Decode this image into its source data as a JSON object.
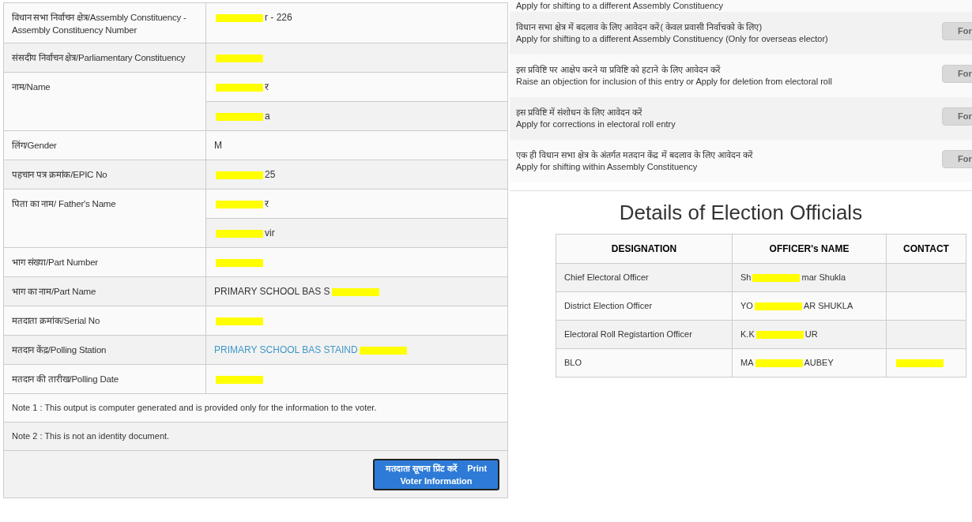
{
  "voter_details": {
    "rows": [
      {
        "label": "विधान सभा निर्वाचन क्षेत्र/Assembly Constituency - Assembly Constituency Number",
        "values": [
          {
            "kind": "text",
            "parts": [
              {
                "kind": "redacted"
              },
              {
                "kind": "text",
                "text": "r - 226"
              }
            ]
          }
        ]
      },
      {
        "label": "संसदीय निर्वाचन क्षेत्र/Parliamentary Constituency",
        "values": [
          {
            "kind": "text",
            "parts": [
              {
                "kind": "redacted"
              }
            ]
          }
        ]
      },
      {
        "label": "नाम/Name",
        "values": [
          {
            "kind": "text",
            "parts": [
              {
                "kind": "redacted"
              },
              {
                "kind": "text",
                "text": "र"
              }
            ]
          },
          {
            "kind": "text",
            "parts": [
              {
                "kind": "redacted"
              },
              {
                "kind": "text",
                "text": "a"
              }
            ]
          }
        ]
      },
      {
        "label": "लिंग/Gender",
        "values": [
          {
            "kind": "text",
            "parts": [
              {
                "kind": "text",
                "text": "M"
              }
            ]
          }
        ]
      },
      {
        "label": "पहचान पत्र क्रमांक/EPIC No",
        "values": [
          {
            "kind": "text",
            "parts": [
              {
                "kind": "redacted"
              },
              {
                "kind": "text",
                "text": "25"
              }
            ]
          }
        ]
      },
      {
        "label": "पिता का नाम/ Father's Name",
        "values": [
          {
            "kind": "text",
            "parts": [
              {
                "kind": "redacted"
              },
              {
                "kind": "text",
                "text": "र"
              }
            ]
          },
          {
            "kind": "text",
            "parts": [
              {
                "kind": "redacted"
              },
              {
                "kind": "text",
                "text": "vir"
              }
            ]
          }
        ]
      },
      {
        "label": "भाग संख्या/Part Number",
        "values": [
          {
            "kind": "text",
            "parts": [
              {
                "kind": "redacted"
              }
            ]
          }
        ]
      },
      {
        "label": "भाग का नाम/Part Name",
        "values": [
          {
            "kind": "text",
            "parts": [
              {
                "kind": "text",
                "text": "PRIMARY SCHOOL BAS S"
              },
              {
                "kind": "redacted"
              }
            ]
          }
        ]
      },
      {
        "label": "मतदाता क्रमांक/Serial No",
        "values": [
          {
            "kind": "text",
            "parts": [
              {
                "kind": "redacted"
              }
            ]
          }
        ]
      },
      {
        "label": "मतदान केंद्र/Polling Station",
        "values": [
          {
            "kind": "link",
            "parts": [
              {
                "kind": "text",
                "text": "PRIMARY SCHOOL BAS STAIND"
              },
              {
                "kind": "redacted"
              }
            ]
          }
        ]
      },
      {
        "label": "मतदान की तारीख/Polling Date",
        "values": [
          {
            "kind": "text",
            "parts": [
              {
                "kind": "redacted"
              }
            ]
          }
        ]
      }
    ],
    "notes": [
      "Note 1 : This output is computer generated and is provided only for the information to the voter.",
      "Note 2 : This is not an identity document."
    ],
    "print_button": {
      "hindi": "मतदाता सूचना प्रिंट करें",
      "english": "Print Voter Information"
    }
  },
  "forms": [
    {
      "english": "Apply for shifting to a different Assembly Constituency"
    },
    {
      "hindi": "विधान सभा क्षेत्र में बदलाव के लिए आवेदन करें( केवल प्रवासी निर्वाचको के लिए)",
      "english": "Apply for shifting to a different Assembly Constituency (Only for overseas elector)",
      "button": "For"
    },
    {
      "hindi": "इस प्रविष्टि पर आक्षेप करने या प्रविष्टि को हटाने के लिए आवेदन करें",
      "english": "Raise an objection for inclusion of this entry or Apply for deletion from electoral roll",
      "button": "For"
    },
    {
      "hindi": "इस प्रविष्टि में संशोधन के लिए आवेदन करें",
      "english": "Apply for corrections in electoral roll entry",
      "button": "For"
    },
    {
      "hindi": "एक ही विधान सभा क्षेत्र के अंतर्गत मतदान केंद्र में बदलाव के लिए आवेदन करें",
      "english": "Apply for shifting within Assembly Constituency",
      "button": "For"
    }
  ],
  "officials": {
    "title": "Details of Election Officials",
    "columns": [
      "DESIGNATION",
      "OFFICER's NAME",
      "CONTACT"
    ],
    "rows": [
      [
        {
          "parts": [
            {
              "kind": "text",
              "text": "Chief Electoral Officer"
            }
          ]
        },
        {
          "parts": [
            {
              "kind": "text",
              "text": "Sh"
            },
            {
              "kind": "redacted"
            },
            {
              "kind": "text",
              "text": "mar Shukla"
            }
          ]
        },
        {}
      ],
      [
        {
          "parts": [
            {
              "kind": "text",
              "text": "District Election Officer"
            }
          ]
        },
        {
          "parts": [
            {
              "kind": "text",
              "text": "YO"
            },
            {
              "kind": "redacted"
            },
            {
              "kind": "text",
              "text": "AR SHUKLA"
            }
          ]
        },
        {}
      ],
      [
        {
          "parts": [
            {
              "kind": "text",
              "text": "Electoral Roll Registartion Officer"
            }
          ]
        },
        {
          "parts": [
            {
              "kind": "text",
              "text": "K.K"
            },
            {
              "kind": "redacted"
            },
            {
              "kind": "text",
              "text": "UR"
            }
          ]
        },
        {}
      ],
      [
        {
          "parts": [
            {
              "kind": "text",
              "text": "BLO"
            }
          ]
        },
        {
          "parts": [
            {
              "kind": "text",
              "text": "MA"
            },
            {
              "kind": "redacted"
            },
            {
              "kind": "text",
              "text": "AUBEY"
            }
          ]
        },
        {
          "parts": [
            {
              "kind": "redacted"
            }
          ]
        }
      ]
    ]
  }
}
